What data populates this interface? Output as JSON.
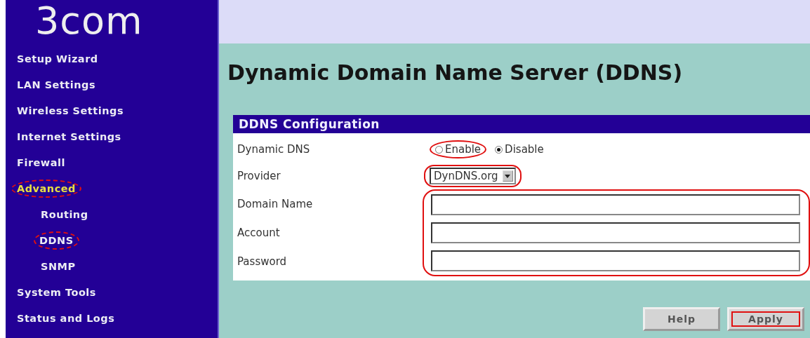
{
  "sidebar": {
    "logo": "3com",
    "items": [
      {
        "label": "Setup Wizard",
        "selected": false,
        "circled": false
      },
      {
        "label": "LAN Settings",
        "selected": false,
        "circled": false
      },
      {
        "label": "Wireless Settings",
        "selected": false,
        "circled": false
      },
      {
        "label": "Internet Settings",
        "selected": false,
        "circled": false
      },
      {
        "label": "Firewall",
        "selected": false,
        "circled": false
      },
      {
        "label": "Advanced",
        "selected": true,
        "circled": true,
        "children": [
          {
            "label": "Routing",
            "selected": false,
            "circled": false
          },
          {
            "label": "DDNS",
            "selected": false,
            "circled": true
          },
          {
            "label": "SNMP",
            "selected": false,
            "circled": false
          }
        ]
      },
      {
        "label": "System Tools",
        "selected": false,
        "circled": false
      },
      {
        "label": "Status and Logs",
        "selected": false,
        "circled": false
      }
    ]
  },
  "page_title": "Dynamic Domain Name Server (DDNS)",
  "form": {
    "title": "DDNS Configuration",
    "fields_circled": true,
    "dynamic_dns": {
      "label": "Dynamic DNS",
      "options": [
        {
          "label": "Enable",
          "selected": false,
          "circled": true
        },
        {
          "label": "Disable",
          "selected": true,
          "circled": false
        }
      ]
    },
    "provider": {
      "label": "Provider",
      "value": "DynDNS.org",
      "circled": true
    },
    "fields": [
      {
        "label": "Domain Name"
      },
      {
        "label": "Account"
      },
      {
        "label": "Password"
      }
    ]
  },
  "buttons": [
    {
      "label": "Help",
      "circled": false
    },
    {
      "label": "Apply",
      "circled": true
    }
  ]
}
